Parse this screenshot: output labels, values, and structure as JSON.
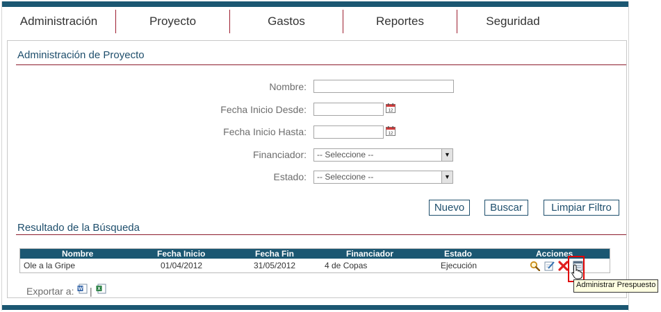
{
  "nav": {
    "items": [
      "Administración",
      "Proyecto",
      "Gastos",
      "Reportes",
      "Seguridad"
    ]
  },
  "admin": {
    "title": "Administración de Proyecto"
  },
  "form": {
    "nombre_label": "Nombre:",
    "nombre_value": "",
    "fecha_desde_label": "Fecha Inicio Desde:",
    "fecha_desde_value": "",
    "fecha_hasta_label": "Fecha Inicio Hasta:",
    "fecha_hasta_value": "",
    "financiador_label": "Financiador:",
    "financiador_value": "-- Seleccione --",
    "estado_label": "Estado:",
    "estado_value": "-- Seleccione --"
  },
  "buttons": {
    "nuevo": "Nuevo",
    "buscar": "Buscar",
    "limpiar": "Limpiar Filtro"
  },
  "results": {
    "title": "Resultado de la Búsqueda",
    "columns": [
      "Nombre",
      "Fecha Inicio",
      "Fecha Fin",
      "Financiador",
      "Estado",
      "Acciones"
    ],
    "rows": [
      {
        "nombre": "Ole a la Gripe",
        "fecha_inicio": "01/04/2012",
        "fecha_fin": "31/05/2012",
        "financiador": "4 de Copas",
        "estado": "Ejecución"
      }
    ],
    "action_icons": [
      "magnifier-icon",
      "edit-icon",
      "delete-icon",
      "budget-icon"
    ]
  },
  "tooltip": {
    "text": "Administrar Prespuesto"
  },
  "export": {
    "label": "Exportar a:",
    "separator": "|"
  },
  "colors": {
    "brand": "#1b5772",
    "accent_rule": "#8b1a2b",
    "delete": "#e02020",
    "highlight": "#e00000"
  }
}
